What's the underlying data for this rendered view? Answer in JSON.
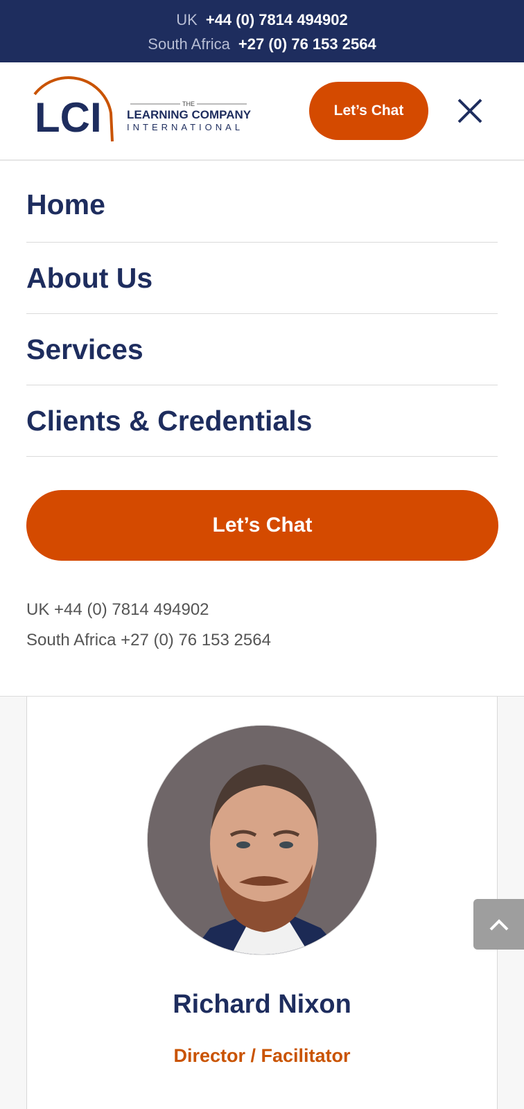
{
  "topbar": {
    "uk_label": "UK",
    "uk_number": "+44 (0) 7814 494902",
    "sa_label": "South Africa",
    "sa_number": "+27 (0) 76 153 2564"
  },
  "logo": {
    "letters": "LCI",
    "the": "THE",
    "line1": "LEARNING COMPANY",
    "line2": "INTERNATIONAL"
  },
  "header": {
    "chat_label": "Let’s Chat",
    "close_icon": "close-icon"
  },
  "menu": {
    "items": [
      {
        "label": "Home"
      },
      {
        "label": "About Us"
      },
      {
        "label": "Services"
      },
      {
        "label": "Clients & Credentials"
      }
    ]
  },
  "cta": {
    "label": "Let’s Chat"
  },
  "contacts": {
    "uk": "UK +44 (0) 7814 494902",
    "sa": "South Africa +27 (0) 76 153 2564"
  },
  "profile": {
    "name": "Richard Nixon",
    "role": "Director / Facilitator"
  },
  "colors": {
    "navy": "#1e2d5e",
    "orange": "#d44a00",
    "role_orange": "#c95300"
  },
  "icons": {
    "close": "close-icon",
    "scroll_top": "chevron-up-icon"
  }
}
